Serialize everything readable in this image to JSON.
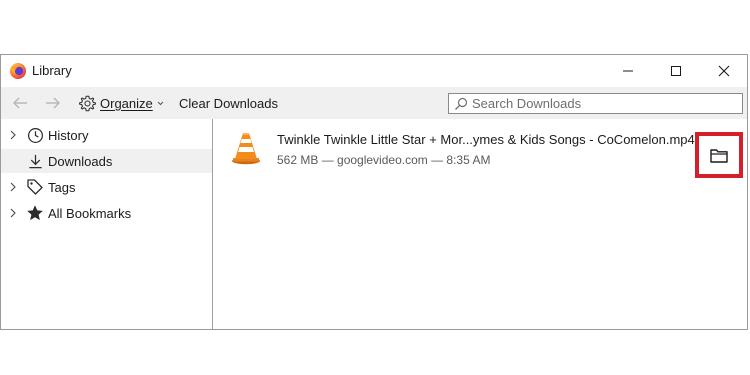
{
  "window": {
    "title": "Library",
    "app_icon": "firefox-icon",
    "controls": [
      "minimize-icon",
      "maximize-icon",
      "close-icon"
    ]
  },
  "toolbar": {
    "back_icon": "arrow-left-icon",
    "forward_icon": "arrow-right-icon",
    "organize_label": "Organize",
    "organize_icon": "gear-icon",
    "clear_label": "Clear Downloads",
    "search_placeholder": "Search Downloads"
  },
  "sidebar": {
    "items": [
      {
        "label": "History",
        "icon": "clock-icon",
        "expandable": true,
        "selected": false
      },
      {
        "label": "Downloads",
        "icon": "download-icon",
        "expandable": false,
        "selected": true
      },
      {
        "label": "Tags",
        "icon": "tag-icon",
        "expandable": true,
        "selected": false
      },
      {
        "label": "All Bookmarks",
        "icon": "star-icon",
        "expandable": true,
        "selected": false
      }
    ]
  },
  "downloads": [
    {
      "name": "Twinkle Twinkle Little Star + Mor...ymes & Kids Songs - CoComelon.mp4",
      "meta": "562 MB — googlevideo.com — 8:35 AM",
      "icon": "vlc-icon",
      "action_icon": "folder-icon"
    }
  ],
  "colors": {
    "highlight_border": "#d4202b",
    "toolbar_bg": "#f0f0f0",
    "vlc_orange": "#f28c1b"
  }
}
